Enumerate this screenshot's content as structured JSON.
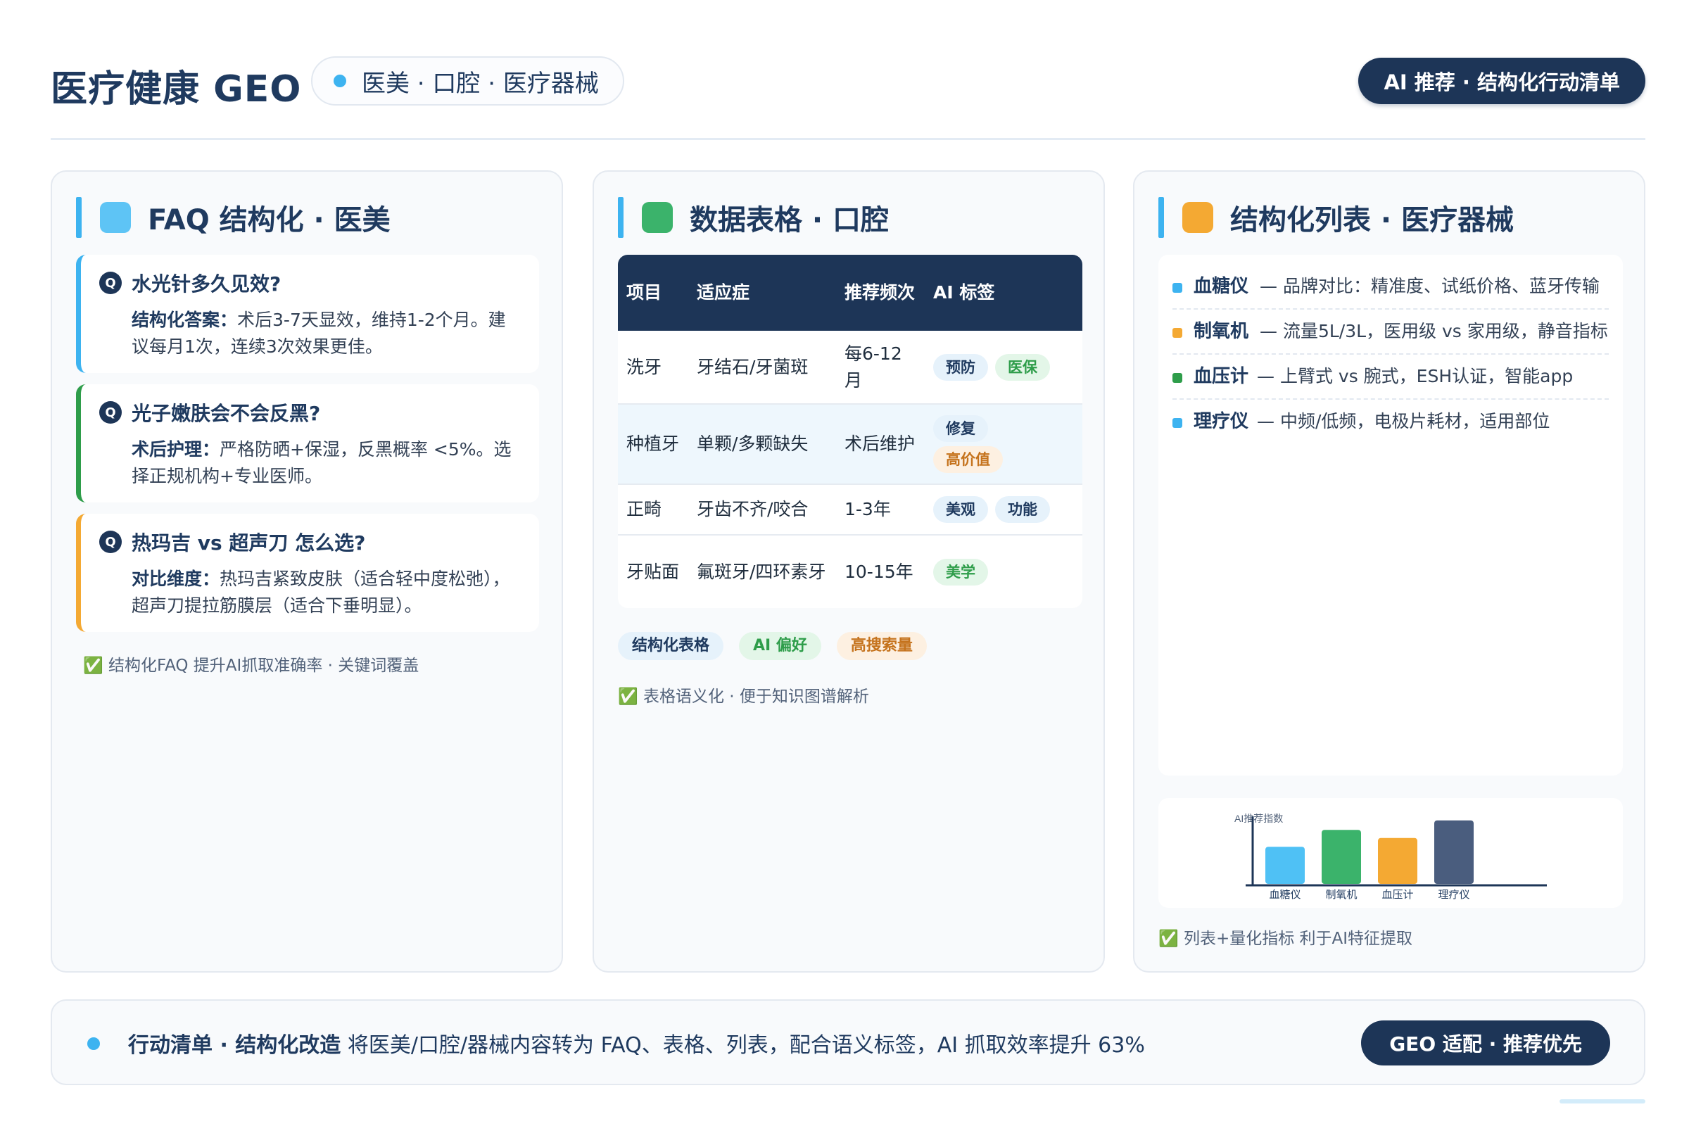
{
  "header": {
    "title": "医疗健康 GEO",
    "subtitle": "医美 · 口腔 · 医疗器械",
    "badge": "AI 推荐 · 结构化行动清单"
  },
  "colors": {
    "navy": "#1d3557",
    "blue": "#3db3f0",
    "green": "#3bb36b",
    "orange": "#f4a933",
    "slate": "#4a5d7e"
  },
  "faq_card": {
    "title": "FAQ 结构化 · 医美",
    "items": [
      {
        "q": "水光针多久见效?",
        "label": "结构化答案：",
        "answer": "术后3-7天显效，维持1-2个月。建议每月1次，连续3次效果更佳。",
        "accent": "#3db3f0"
      },
      {
        "q": "光子嫩肤会不会反黑?",
        "label": "术后护理：",
        "answer": "严格防晒+保湿，反黑概率 <5%。选择正规机构+专业医师。",
        "accent": "#2e9d4a"
      },
      {
        "q": "热玛吉 vs 超声刀 怎么选?",
        "label": "对比维度：",
        "answer": "热玛吉紧致皮肤（适合轻中度松弛），超声刀提拉筋膜层（适合下垂明显）。",
        "accent": "#f4a933"
      }
    ],
    "note": "✅ 结构化FAQ 提升AI抓取准确率 · 关键词覆盖"
  },
  "table_card": {
    "title": "数据表格 · 口腔",
    "headers": [
      "项目",
      "适应症",
      "推荐频次",
      "AI 标签"
    ],
    "rows": [
      {
        "item": "洗牙",
        "indication": "牙结石/牙菌斑",
        "freq": "每6-12月",
        "tags": [
          {
            "text": "预防",
            "style": "blue"
          },
          {
            "text": "医保",
            "style": "green"
          }
        ]
      },
      {
        "item": "种植牙",
        "indication": "单颗/多颗缺失",
        "freq": "术后维护",
        "tags": [
          {
            "text": "修复",
            "style": "blue"
          },
          {
            "text": "高价值",
            "style": "orange"
          }
        ]
      },
      {
        "item": "正畸",
        "indication": "牙齿不齐/咬合",
        "freq": "1-3年",
        "tags": [
          {
            "text": "美观",
            "style": "blue"
          },
          {
            "text": "功能",
            "style": "blue"
          }
        ]
      },
      {
        "item": "牙贴面",
        "indication": "氟斑牙/四环素牙",
        "freq": "10-15年",
        "tags": [
          {
            "text": "美学",
            "style": "green"
          }
        ]
      }
    ],
    "chips": [
      {
        "text": "结构化表格",
        "style": "blue"
      },
      {
        "text": "AI 偏好",
        "style": "green"
      },
      {
        "text": "高搜索量",
        "style": "orange"
      }
    ],
    "note": "✅ 表格语义化 · 便于知识图谱解析"
  },
  "list_card": {
    "title": "结构化列表 · 医疗器械",
    "items": [
      {
        "name": "血糖仪",
        "desc": "— 品牌对比：精准度、试纸价格、蓝牙传输",
        "color": "#3db3f0"
      },
      {
        "name": "制氧机",
        "desc": "— 流量5L/3L，医用级 vs 家用级，静音指标",
        "color": "#f4a933"
      },
      {
        "name": "血压计",
        "desc": "— 上臂式 vs 腕式，ESH认证，智能app",
        "color": "#2e9d4a"
      },
      {
        "name": "理疗仪",
        "desc": "— 中频/低频，电极片耗材，适用部位",
        "color": "#3db3f0"
      }
    ],
    "note": "✅ 列表+量化指标 利于AI特征提取"
  },
  "chart_data": {
    "type": "bar",
    "title": "",
    "ylabel": "AI推荐指数",
    "xlabel": "",
    "categories": [
      "血糖仪",
      "制氧机",
      "血压计",
      "理疗仪"
    ],
    "values": [
      55,
      80,
      68,
      94
    ],
    "ylim": [
      0,
      100
    ],
    "colors": [
      "#4fc1f5",
      "#3bb36b",
      "#f4a933",
      "#4a5d7e"
    ],
    "grid": false
  },
  "footer": {
    "label": "行动清单 · 结构化改造",
    "text": "将医美/口腔/器械内容转为 FAQ、表格、列表，配合语义标签，AI 抓取效率提升 63%",
    "button": "GEO 适配 · 推荐优先"
  }
}
